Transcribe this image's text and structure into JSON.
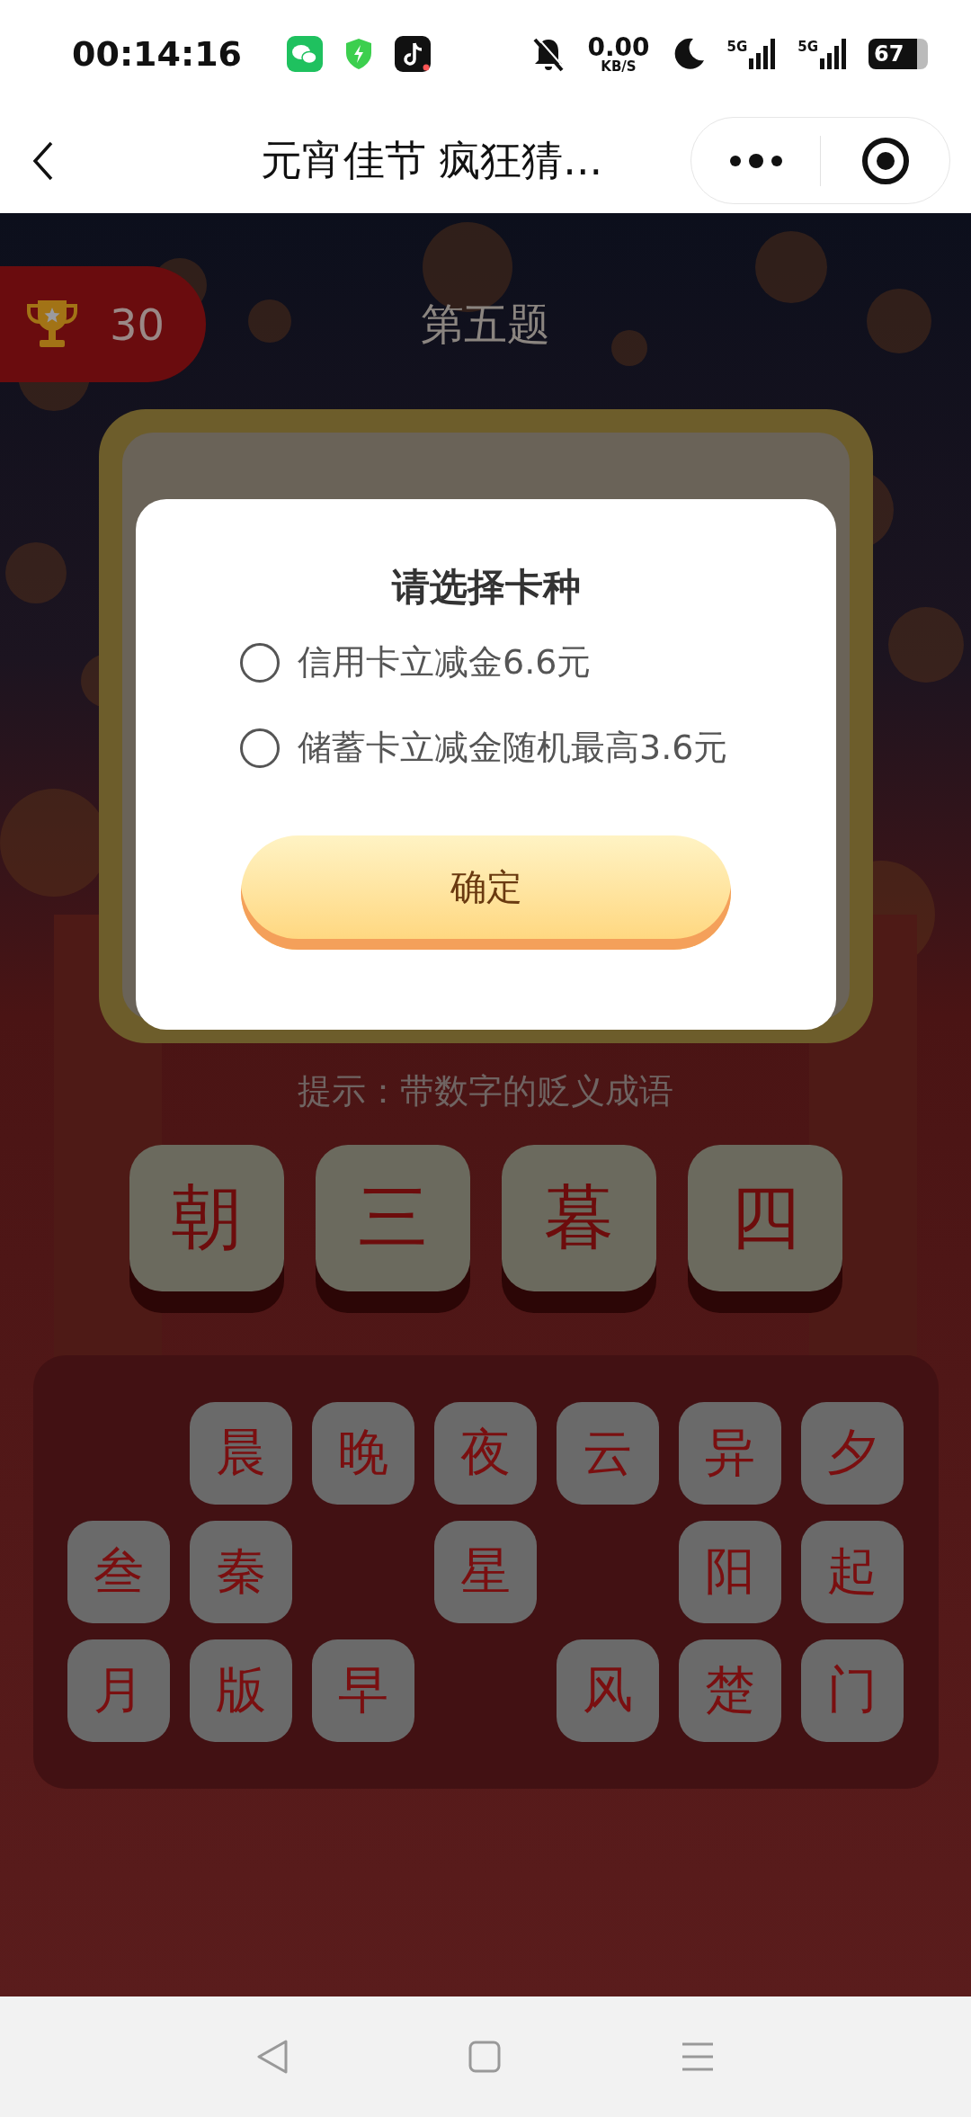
{
  "status_bar": {
    "time": "00:14:16",
    "net_speed": "0.00",
    "net_unit": "KB/S",
    "signals": [
      "5G",
      "5G"
    ],
    "battery": "67"
  },
  "nav": {
    "title": "元宵佳节 疯狂猜..."
  },
  "score": "30",
  "question_title": "第五题",
  "dialog": {
    "title": "请选择卡种",
    "options": [
      {
        "label": "信用卡立减金6.6元",
        "selected": false
      },
      {
        "label": "储蓄卡立减金随机最高3.6元",
        "selected": false
      }
    ],
    "confirm": "确定"
  },
  "hint": "提示：带数字的贬义成语",
  "answer": [
    "朝",
    "三",
    "暮",
    "四"
  ],
  "keyboard": [
    {
      "kind": "blank"
    },
    {
      "kind": "char",
      "char": "晨"
    },
    {
      "kind": "char",
      "char": "晚"
    },
    {
      "kind": "char",
      "char": "夜"
    },
    {
      "kind": "char",
      "char": "云"
    },
    {
      "kind": "char",
      "char": "异"
    },
    {
      "kind": "char",
      "char": "夕"
    },
    {
      "kind": "char",
      "char": "叁"
    },
    {
      "kind": "char",
      "char": "秦"
    },
    {
      "kind": "blank"
    },
    {
      "kind": "char",
      "char": "星"
    },
    {
      "kind": "blank"
    },
    {
      "kind": "char",
      "char": "阳"
    },
    {
      "kind": "char",
      "char": "起"
    },
    {
      "kind": "char",
      "char": "月"
    },
    {
      "kind": "char",
      "char": "版"
    },
    {
      "kind": "char",
      "char": "早"
    },
    {
      "kind": "blank"
    },
    {
      "kind": "char",
      "char": "风"
    },
    {
      "kind": "char",
      "char": "楚"
    },
    {
      "kind": "char",
      "char": "门"
    }
  ]
}
